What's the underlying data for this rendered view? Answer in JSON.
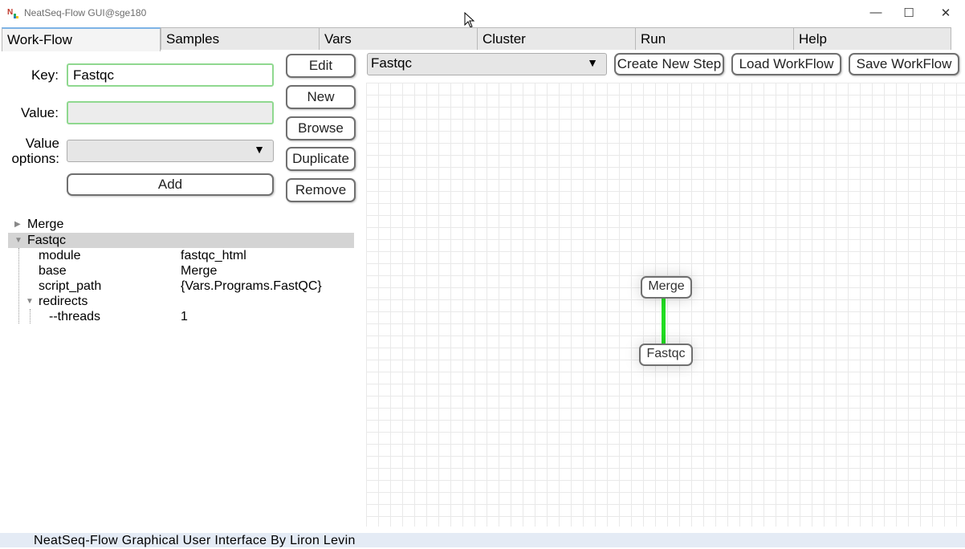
{
  "window": {
    "title": "NeatSeq-Flow GUI@sge180",
    "controls": {
      "minimize": "—",
      "maximize": "☐",
      "close": "✕"
    }
  },
  "tabs": [
    {
      "label": "Work-Flow"
    },
    {
      "label": "Samples"
    },
    {
      "label": "Vars"
    },
    {
      "label": "Cluster"
    },
    {
      "label": "Run"
    },
    {
      "label": "Help"
    }
  ],
  "form": {
    "key_label": "Key:",
    "key_value": "Fastqc",
    "value_label": "Value:",
    "value_value": "",
    "value_options_label_1": "Value",
    "value_options_label_2": "options:",
    "value_options_selected": "",
    "add_label": "Add"
  },
  "side_buttons": {
    "edit": "Edit",
    "new": "New",
    "browse": "Browse",
    "duplicate": "Duplicate",
    "remove": "Remove"
  },
  "toolbar": {
    "step_selected": "Fastqc",
    "create_new_step": "Create New Step",
    "load_workflow": "Load WorkFlow",
    "save_workflow": "Save WorkFlow"
  },
  "tree": {
    "items": [
      {
        "key": "Merge",
        "value": ""
      },
      {
        "key": "Fastqc",
        "value": ""
      },
      {
        "key": "module",
        "value": "fastqc_html"
      },
      {
        "key": "base",
        "value": "Merge"
      },
      {
        "key": "script_path",
        "value": "{Vars.Programs.FastQC}"
      },
      {
        "key": "redirects",
        "value": ""
      },
      {
        "key": "--threads",
        "value": "1"
      }
    ]
  },
  "graph": {
    "nodes": [
      {
        "label": "Merge"
      },
      {
        "label": "Fastqc"
      }
    ],
    "edge_color": "#22dd22"
  },
  "status": {
    "text": "NeatSeq-Flow Graphical User Interface By Liron Levin"
  },
  "colors": {
    "active_tab_accent": "#7db3e6",
    "field_border": "#8fd88f"
  },
  "icons": [
    "app-icon",
    "dropdown-arrow-icon",
    "expand-icon",
    "collapse-icon",
    "cursor-icon"
  ]
}
